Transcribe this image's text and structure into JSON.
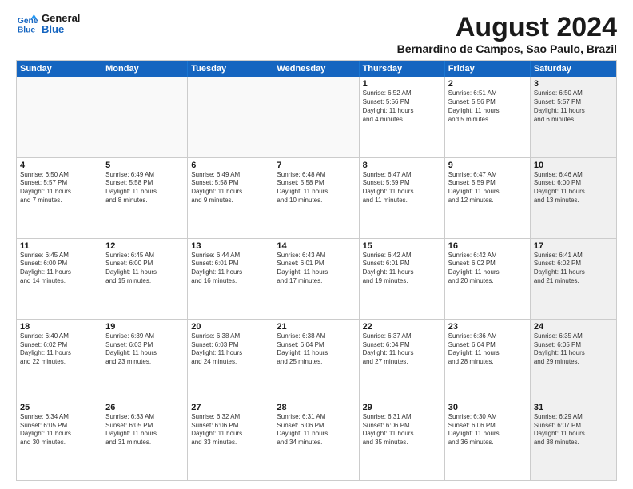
{
  "logo": {
    "line1": "General",
    "line2": "Blue"
  },
  "title": "August 2024",
  "subtitle": "Bernardino de Campos, Sao Paulo, Brazil",
  "header_days": [
    "Sunday",
    "Monday",
    "Tuesday",
    "Wednesday",
    "Thursday",
    "Friday",
    "Saturday"
  ],
  "weeks": [
    [
      {
        "day": "",
        "info": "",
        "empty": true
      },
      {
        "day": "",
        "info": "",
        "empty": true
      },
      {
        "day": "",
        "info": "",
        "empty": true
      },
      {
        "day": "",
        "info": "",
        "empty": true
      },
      {
        "day": "1",
        "info": "Sunrise: 6:52 AM\nSunset: 5:56 PM\nDaylight: 11 hours\nand 4 minutes."
      },
      {
        "day": "2",
        "info": "Sunrise: 6:51 AM\nSunset: 5:56 PM\nDaylight: 11 hours\nand 5 minutes."
      },
      {
        "day": "3",
        "info": "Sunrise: 6:50 AM\nSunset: 5:57 PM\nDaylight: 11 hours\nand 6 minutes.",
        "shaded": true
      }
    ],
    [
      {
        "day": "4",
        "info": "Sunrise: 6:50 AM\nSunset: 5:57 PM\nDaylight: 11 hours\nand 7 minutes."
      },
      {
        "day": "5",
        "info": "Sunrise: 6:49 AM\nSunset: 5:58 PM\nDaylight: 11 hours\nand 8 minutes."
      },
      {
        "day": "6",
        "info": "Sunrise: 6:49 AM\nSunset: 5:58 PM\nDaylight: 11 hours\nand 9 minutes."
      },
      {
        "day": "7",
        "info": "Sunrise: 6:48 AM\nSunset: 5:58 PM\nDaylight: 11 hours\nand 10 minutes."
      },
      {
        "day": "8",
        "info": "Sunrise: 6:47 AM\nSunset: 5:59 PM\nDaylight: 11 hours\nand 11 minutes."
      },
      {
        "day": "9",
        "info": "Sunrise: 6:47 AM\nSunset: 5:59 PM\nDaylight: 11 hours\nand 12 minutes."
      },
      {
        "day": "10",
        "info": "Sunrise: 6:46 AM\nSunset: 6:00 PM\nDaylight: 11 hours\nand 13 minutes.",
        "shaded": true
      }
    ],
    [
      {
        "day": "11",
        "info": "Sunrise: 6:45 AM\nSunset: 6:00 PM\nDaylight: 11 hours\nand 14 minutes."
      },
      {
        "day": "12",
        "info": "Sunrise: 6:45 AM\nSunset: 6:00 PM\nDaylight: 11 hours\nand 15 minutes."
      },
      {
        "day": "13",
        "info": "Sunrise: 6:44 AM\nSunset: 6:01 PM\nDaylight: 11 hours\nand 16 minutes."
      },
      {
        "day": "14",
        "info": "Sunrise: 6:43 AM\nSunset: 6:01 PM\nDaylight: 11 hours\nand 17 minutes."
      },
      {
        "day": "15",
        "info": "Sunrise: 6:42 AM\nSunset: 6:01 PM\nDaylight: 11 hours\nand 19 minutes."
      },
      {
        "day": "16",
        "info": "Sunrise: 6:42 AM\nSunset: 6:02 PM\nDaylight: 11 hours\nand 20 minutes."
      },
      {
        "day": "17",
        "info": "Sunrise: 6:41 AM\nSunset: 6:02 PM\nDaylight: 11 hours\nand 21 minutes.",
        "shaded": true
      }
    ],
    [
      {
        "day": "18",
        "info": "Sunrise: 6:40 AM\nSunset: 6:02 PM\nDaylight: 11 hours\nand 22 minutes."
      },
      {
        "day": "19",
        "info": "Sunrise: 6:39 AM\nSunset: 6:03 PM\nDaylight: 11 hours\nand 23 minutes."
      },
      {
        "day": "20",
        "info": "Sunrise: 6:38 AM\nSunset: 6:03 PM\nDaylight: 11 hours\nand 24 minutes."
      },
      {
        "day": "21",
        "info": "Sunrise: 6:38 AM\nSunset: 6:04 PM\nDaylight: 11 hours\nand 25 minutes."
      },
      {
        "day": "22",
        "info": "Sunrise: 6:37 AM\nSunset: 6:04 PM\nDaylight: 11 hours\nand 27 minutes."
      },
      {
        "day": "23",
        "info": "Sunrise: 6:36 AM\nSunset: 6:04 PM\nDaylight: 11 hours\nand 28 minutes."
      },
      {
        "day": "24",
        "info": "Sunrise: 6:35 AM\nSunset: 6:05 PM\nDaylight: 11 hours\nand 29 minutes.",
        "shaded": true
      }
    ],
    [
      {
        "day": "25",
        "info": "Sunrise: 6:34 AM\nSunset: 6:05 PM\nDaylight: 11 hours\nand 30 minutes."
      },
      {
        "day": "26",
        "info": "Sunrise: 6:33 AM\nSunset: 6:05 PM\nDaylight: 11 hours\nand 31 minutes."
      },
      {
        "day": "27",
        "info": "Sunrise: 6:32 AM\nSunset: 6:06 PM\nDaylight: 11 hours\nand 33 minutes."
      },
      {
        "day": "28",
        "info": "Sunrise: 6:31 AM\nSunset: 6:06 PM\nDaylight: 11 hours\nand 34 minutes."
      },
      {
        "day": "29",
        "info": "Sunrise: 6:31 AM\nSunset: 6:06 PM\nDaylight: 11 hours\nand 35 minutes."
      },
      {
        "day": "30",
        "info": "Sunrise: 6:30 AM\nSunset: 6:06 PM\nDaylight: 11 hours\nand 36 minutes."
      },
      {
        "day": "31",
        "info": "Sunrise: 6:29 AM\nSunset: 6:07 PM\nDaylight: 11 hours\nand 38 minutes.",
        "shaded": true
      }
    ]
  ]
}
